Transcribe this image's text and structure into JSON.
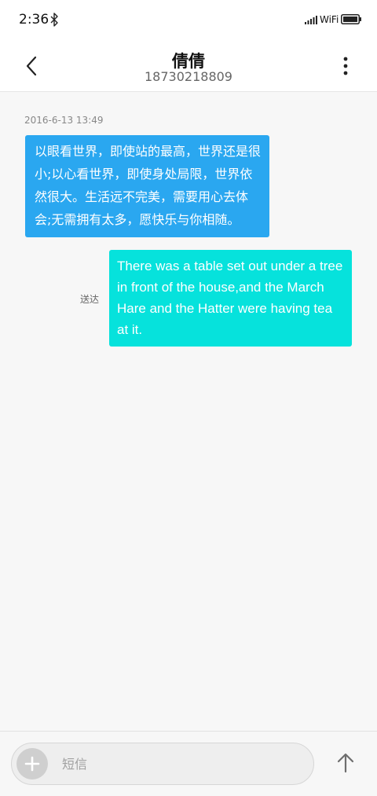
{
  "status_bar": {
    "time": "2:36",
    "bluetooth_icon": "bluetooth-icon",
    "signal_icon": "signal-icon",
    "network_label": "WiFi",
    "battery_icon": "battery-icon"
  },
  "header": {
    "back_icon": "chevron-left-icon",
    "contact_name": "倩倩",
    "contact_number": "18730218809",
    "more_icon": "more-vertical-icon"
  },
  "conversation": {
    "timestamp": "2016-6-13 13:49",
    "messages": [
      {
        "direction": "incoming",
        "text": "以眼看世界，即使站的最高，世界还是很小;以心看世界，即使身处局限，世界依然很大。生活远不完美，需要用心去体会;无需拥有太多，愿快乐与你相随。",
        "color": "#2aa7f0"
      },
      {
        "direction": "outgoing",
        "text": "There was a table set out under a tree in front of the house,and the March Hare and the Hatter were having tea at it.",
        "status": "送达",
        "color": "#06e2dc"
      }
    ]
  },
  "composer": {
    "add_icon": "plus-icon",
    "placeholder": "短信",
    "value": "",
    "send_icon": "arrow-up-icon"
  }
}
